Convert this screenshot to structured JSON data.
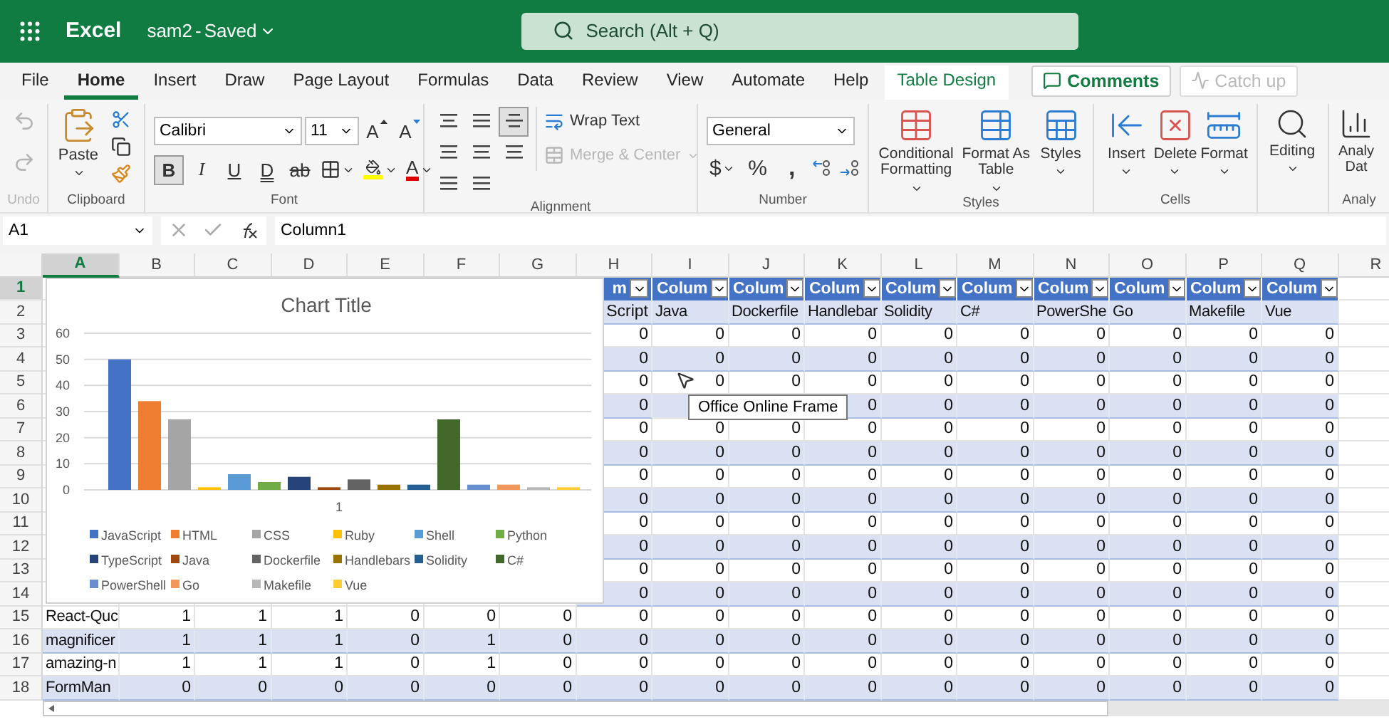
{
  "app_bar": {
    "app_name": "Excel",
    "file_name": "sam2",
    "separator": "-",
    "status": "Saved",
    "search_placeholder": "Search (Alt + Q)"
  },
  "menu_tabs": [
    {
      "label": "File",
      "selected": false,
      "kind": "standard"
    },
    {
      "label": "Home",
      "selected": true,
      "kind": "standard"
    },
    {
      "label": "Insert",
      "selected": false,
      "kind": "standard"
    },
    {
      "label": "Draw",
      "selected": false,
      "kind": "standard"
    },
    {
      "label": "Page Layout",
      "selected": false,
      "kind": "standard"
    },
    {
      "label": "Formulas",
      "selected": false,
      "kind": "standard"
    },
    {
      "label": "Data",
      "selected": false,
      "kind": "standard"
    },
    {
      "label": "Review",
      "selected": false,
      "kind": "standard"
    },
    {
      "label": "View",
      "selected": false,
      "kind": "standard"
    },
    {
      "label": "Automate",
      "selected": false,
      "kind": "standard"
    },
    {
      "label": "Help",
      "selected": false,
      "kind": "standard"
    },
    {
      "label": "Table Design",
      "selected": false,
      "kind": "contextual"
    }
  ],
  "header_buttons": [
    {
      "label": "Comments",
      "disabled": false
    },
    {
      "label": "Catch up",
      "disabled": true
    }
  ],
  "ribbon": {
    "undo": {
      "label": "Undo",
      "disabled": true
    },
    "clipboard": {
      "label": "Clipboard",
      "paste": "Paste"
    },
    "font": {
      "label": "Font",
      "name": "Calibri",
      "size": "11",
      "grow": "A",
      "shrink": "A",
      "font_color": "A",
      "styles": [
        {
          "text": "B",
          "kind": "bold",
          "selected": true
        },
        {
          "text": "I",
          "kind": "italic",
          "selected": false
        },
        {
          "text": "U",
          "kind": "underline",
          "selected": false
        },
        {
          "text": "D",
          "kind": "double",
          "selected": false
        },
        {
          "text": "ab",
          "kind": "strike",
          "selected": false
        }
      ]
    },
    "alignment": {
      "label": "Alignment",
      "vertical": [
        {
          "selected": false
        },
        {
          "selected": false
        },
        {
          "selected": true
        }
      ],
      "wrap_text": "Wrap Text",
      "merge": {
        "label": "Merge & Center",
        "disabled": true
      }
    },
    "number": {
      "label": "Number",
      "format": "General",
      "currency": "$",
      "percent": "%",
      "comma": ","
    },
    "styles": {
      "label": "Styles",
      "buttons": [
        {
          "label": "Conditional Formatting",
          "kind": "conditional"
        },
        {
          "label": "Format As Table",
          "kind": "table"
        },
        {
          "label": "Styles",
          "kind": "styles"
        }
      ]
    },
    "cells": {
      "label": "Cells",
      "buttons": [
        {
          "label": "Insert",
          "kind": "insert"
        },
        {
          "label": "Delete",
          "kind": "delete"
        },
        {
          "label": "Format",
          "kind": "format"
        }
      ]
    },
    "editing": {
      "label": "Editing"
    },
    "analyze": {
      "label": "Analy",
      "button": "Analy Dat"
    }
  },
  "formula_bar": {
    "name_box": "A1",
    "formula": "Column1"
  },
  "grid": {
    "columns": [
      {
        "label": "A",
        "selected": true
      },
      {
        "label": "B",
        "selected": false
      },
      {
        "label": "C",
        "selected": false
      },
      {
        "label": "D",
        "selected": false
      },
      {
        "label": "E",
        "selected": false
      },
      {
        "label": "F",
        "selected": false
      },
      {
        "label": "G",
        "selected": false
      },
      {
        "label": "H",
        "selected": false
      },
      {
        "label": "I",
        "selected": false
      },
      {
        "label": "J",
        "selected": false
      },
      {
        "label": "K",
        "selected": false
      },
      {
        "label": "L",
        "selected": false
      },
      {
        "label": "M",
        "selected": false
      },
      {
        "label": "N",
        "selected": false
      },
      {
        "label": "O",
        "selected": false
      },
      {
        "label": "P",
        "selected": false
      },
      {
        "label": "Q",
        "selected": false
      },
      {
        "label": "R",
        "selected": false
      }
    ],
    "rows": [
      {
        "label": "1",
        "selected": true,
        "kind": "header",
        "cells": [
          "m",
          "Colum",
          "Colum",
          "Colum",
          "Colum",
          "Colum",
          "Colum",
          "Colum",
          "Colum",
          "Colum"
        ]
      },
      {
        "label": "2",
        "selected": false,
        "kind": "labels",
        "cells": [
          "Script",
          "Java",
          "Dockerfile",
          "Handlebar",
          "Solidity",
          "C#",
          "PowerShe",
          "Go",
          "Makefile",
          "Vue"
        ]
      },
      {
        "label": "3",
        "selected": false,
        "kind": "data",
        "cells": [
          "0",
          "0",
          "0",
          "0",
          "0",
          "0",
          "0",
          "0",
          "0",
          "0"
        ]
      },
      {
        "label": "4",
        "selected": false,
        "kind": "data",
        "cells": [
          "0",
          "0",
          "0",
          "0",
          "0",
          "0",
          "0",
          "0",
          "0",
          "0"
        ]
      },
      {
        "label": "5",
        "selected": false,
        "kind": "data",
        "cells": [
          "0",
          "0",
          "0",
          "0",
          "0",
          "0",
          "0",
          "0",
          "0",
          "0"
        ]
      },
      {
        "label": "6",
        "selected": false,
        "kind": "data",
        "cells": [
          "0",
          null,
          null,
          "0",
          "0",
          "0",
          "0",
          "0",
          "0",
          "0"
        ]
      },
      {
        "label": "7",
        "selected": false,
        "kind": "data",
        "cells": [
          "0",
          "0",
          "0",
          "0",
          "0",
          "0",
          "0",
          "0",
          "0",
          "0"
        ]
      },
      {
        "label": "8",
        "selected": false,
        "kind": "data",
        "cells": [
          "0",
          "0",
          "0",
          "0",
          "0",
          "0",
          "0",
          "0",
          "0",
          "0"
        ]
      },
      {
        "label": "9",
        "selected": false,
        "kind": "data",
        "cells": [
          "0",
          "0",
          "0",
          "0",
          "0",
          "0",
          "0",
          "0",
          "0",
          "0"
        ]
      },
      {
        "label": "10",
        "selected": false,
        "kind": "data",
        "cells": [
          "0",
          "0",
          "0",
          "0",
          "0",
          "0",
          "0",
          "0",
          "0",
          "0"
        ]
      },
      {
        "label": "11",
        "selected": false,
        "kind": "data",
        "cells": [
          "0",
          "0",
          "0",
          "0",
          "0",
          "0",
          "0",
          "0",
          "0",
          "0"
        ]
      },
      {
        "label": "12",
        "selected": false,
        "kind": "data",
        "cells": [
          "0",
          "0",
          "0",
          "0",
          "0",
          "0",
          "0",
          "0",
          "0",
          "0"
        ]
      },
      {
        "label": "13",
        "selected": false,
        "kind": "data",
        "cells": [
          "0",
          "0",
          "0",
          "0",
          "0",
          "0",
          "0",
          "0",
          "0",
          "0"
        ]
      },
      {
        "label": "14",
        "selected": false,
        "kind": "data",
        "cells": [
          "0",
          "0",
          "0",
          "0",
          "0",
          "0",
          "0",
          "0",
          "0",
          "0"
        ]
      },
      {
        "label": "15",
        "selected": false,
        "kind": "data",
        "cells": [
          "React-Quc",
          "1",
          "1",
          "1",
          "0",
          "0",
          "0",
          "0",
          "0",
          "0",
          "0",
          "0",
          "0",
          "0",
          "0",
          "0",
          "0"
        ]
      },
      {
        "label": "16",
        "selected": false,
        "kind": "data",
        "cells": [
          "magnificer",
          "1",
          "1",
          "1",
          "0",
          "1",
          "0",
          "0",
          "0",
          "0",
          "0",
          "0",
          "0",
          "0",
          "0",
          "0",
          "0"
        ]
      },
      {
        "label": "17",
        "selected": false,
        "kind": "data",
        "cells": [
          "amazing-n",
          "1",
          "1",
          "1",
          "0",
          "1",
          "0",
          "0",
          "0",
          "0",
          "0",
          "0",
          "0",
          "0",
          "0",
          "0",
          "0"
        ]
      },
      {
        "label": "18",
        "selected": false,
        "kind": "data",
        "cells": [
          "FormMan",
          "0",
          "0",
          "0",
          "0",
          "0",
          "0",
          "0",
          "0",
          "0",
          "0",
          "0",
          "0",
          "0",
          "0",
          "0",
          "0"
        ]
      }
    ]
  },
  "chart": {
    "chart_data": {
      "type": "bar",
      "title": "Chart Title",
      "categories": [
        "1"
      ],
      "grid": true,
      "legend": "bottom",
      "ylim": [
        0,
        60
      ],
      "yticks": [
        0,
        10,
        20,
        30,
        40,
        50,
        60
      ],
      "series": [
        {
          "name": "JavaScript",
          "color": "#4472c4",
          "values": [
            50
          ]
        },
        {
          "name": "HTML",
          "color": "#ed7d31",
          "values": [
            34
          ]
        },
        {
          "name": "CSS",
          "color": "#a5a5a5",
          "values": [
            27
          ]
        },
        {
          "name": "Ruby",
          "color": "#ffc000",
          "values": [
            1
          ]
        },
        {
          "name": "Shell",
          "color": "#5b9bd5",
          "values": [
            6
          ]
        },
        {
          "name": "Python",
          "color": "#70ad47",
          "values": [
            3
          ]
        },
        {
          "name": "TypeScript",
          "color": "#264478",
          "values": [
            5
          ]
        },
        {
          "name": "Java",
          "color": "#9e480e",
          "values": [
            1
          ]
        },
        {
          "name": "Dockerfile",
          "color": "#636363",
          "values": [
            4
          ]
        },
        {
          "name": "Handlebars",
          "color": "#997300",
          "values": [
            2
          ]
        },
        {
          "name": "Solidity",
          "color": "#255e91",
          "values": [
            2
          ]
        },
        {
          "name": "C#",
          "color": "#43682b",
          "values": [
            27
          ]
        },
        {
          "name": "PowerShell",
          "color": "#698ed0",
          "values": [
            2
          ]
        },
        {
          "name": "Go",
          "color": "#f1975a",
          "values": [
            2
          ]
        },
        {
          "name": "Makefile",
          "color": "#b7b7b7",
          "values": [
            1
          ]
        },
        {
          "name": "Vue",
          "color": "#ffcd33",
          "values": [
            1
          ]
        }
      ]
    }
  },
  "tooltip": "Office Online Frame"
}
